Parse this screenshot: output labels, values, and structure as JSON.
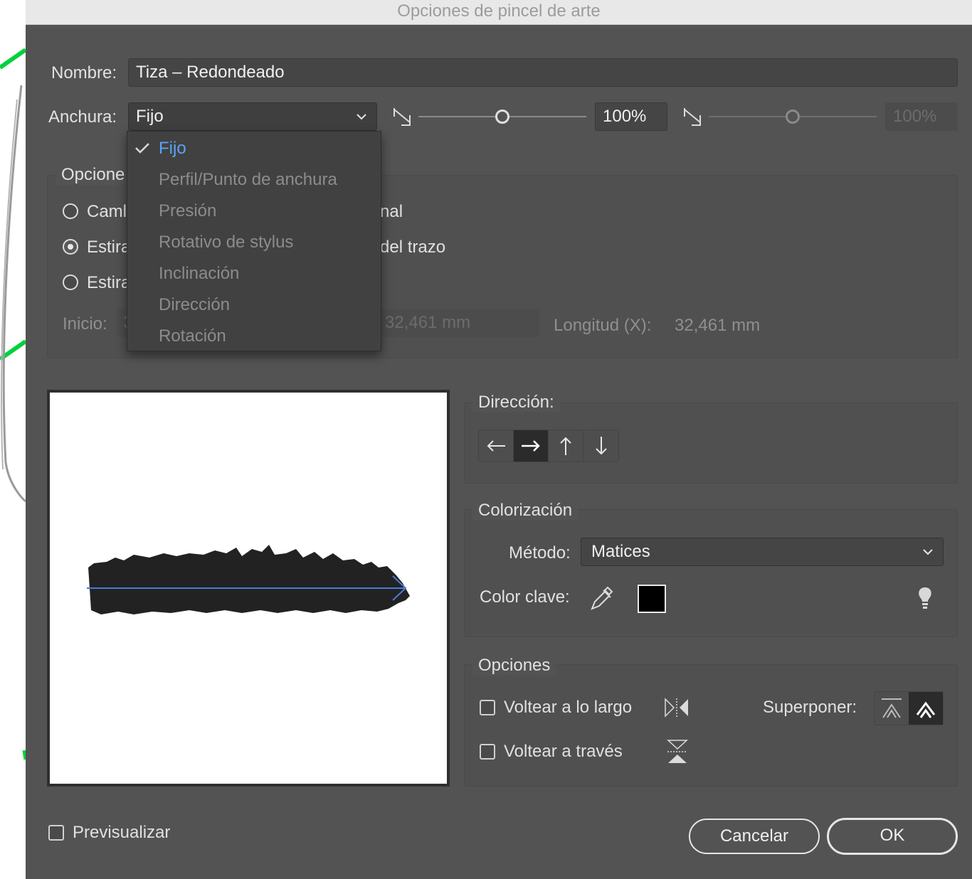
{
  "window": {
    "title": "Opciones de pincel de arte"
  },
  "name": {
    "label": "Nombre:",
    "value": "Tiza – Redondeado"
  },
  "width": {
    "label": "Anchura:",
    "selected": "Fijo",
    "percent": "100%",
    "percent_disabled": "100%",
    "slider_value": 0.5,
    "slider2_value": 0.5
  },
  "width_menu": {
    "items": [
      "Fijo",
      "Perfil/Punto de anchura",
      "Presión",
      "Rotativo de stylus",
      "Inclinación",
      "Dirección",
      "Rotación"
    ],
    "selected_index": 0
  },
  "scale_options": {
    "title_visible": "Opcione",
    "radio1": {
      "left": "Caml",
      "right": "nal",
      "checked": false
    },
    "radio2": {
      "left": "Estira",
      "right": "del trazo",
      "checked": true
    },
    "radio3": {
      "left": "Estira",
      "checked": false
    },
    "start_label": "Inicio:",
    "start_value": "3",
    "end_value": "32,461 mm",
    "length_label": "Longitud (X):",
    "length_value": "32,461 mm"
  },
  "direction": {
    "title": "Dirección:",
    "buttons": [
      "arrow-left-icon",
      "arrow-right-icon",
      "arrow-up-icon",
      "arrow-down-icon"
    ],
    "selected_index": 1
  },
  "colorization": {
    "title": "Colorización",
    "method_label": "Método:",
    "method_value": "Matices",
    "key_color_label": "Color clave:",
    "key_color": "#000000"
  },
  "options": {
    "title": "Opciones",
    "flip_along": {
      "label": "Voltear a lo largo",
      "checked": false
    },
    "flip_across": {
      "label": "Voltear a través",
      "checked": false
    },
    "overlap_label": "Superponer:",
    "overlap_selected_index": 1
  },
  "footer": {
    "preview_label": "Previsualizar",
    "preview_checked": false,
    "cancel_label": "Cancelar",
    "ok_label": "OK"
  },
  "colors": {
    "dialog_bg": "#535353",
    "accent_blue": "#5ba3f5",
    "canvas_stroke_green": "#00d23c",
    "brush_fill": "#222222",
    "path_blue": "#4a7bd8"
  }
}
